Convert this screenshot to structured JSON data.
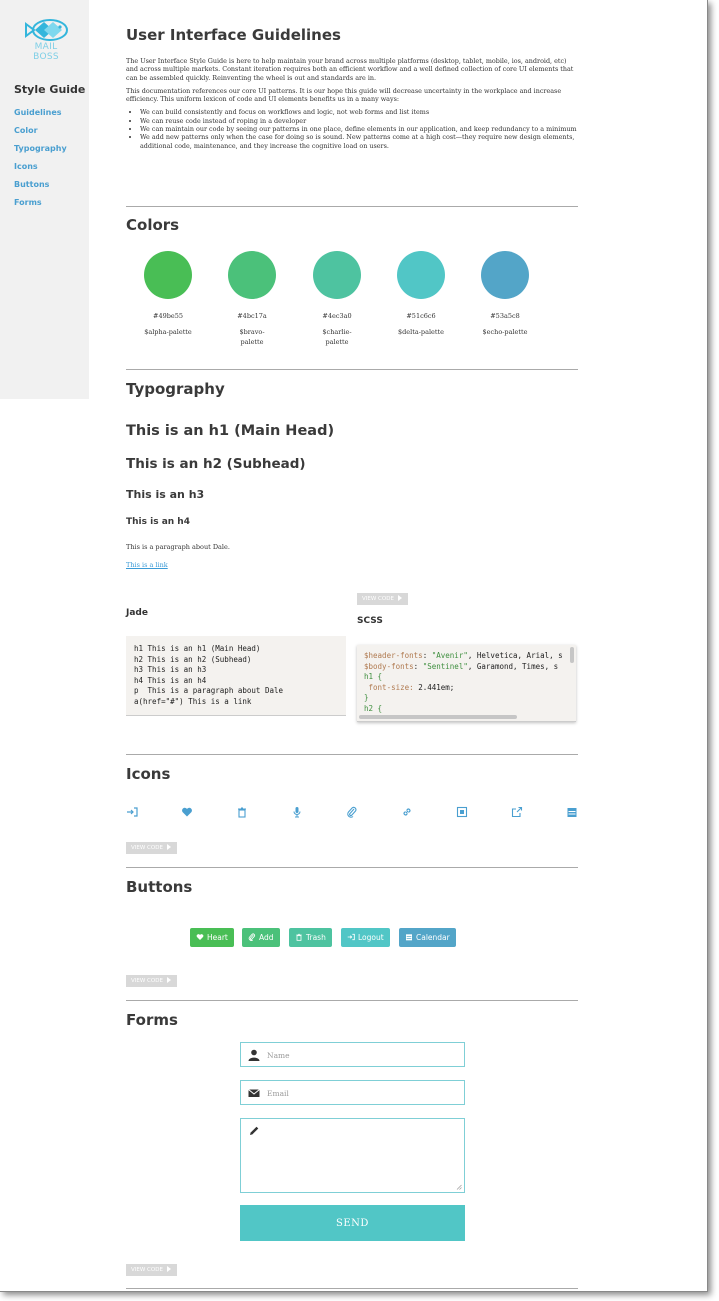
{
  "brand": {
    "logo_line1": "MAIL",
    "logo_line2": "BOSS",
    "accent": "#4a9fd0"
  },
  "sidebar": {
    "title": "Style Guide",
    "items": [
      {
        "label": "Guidelines"
      },
      {
        "label": "Color"
      },
      {
        "label": "Typography"
      },
      {
        "label": "Icons"
      },
      {
        "label": "Buttons"
      },
      {
        "label": "Forms"
      }
    ]
  },
  "intro": {
    "title": "User Interface Guidelines",
    "para1": "The User Interface Style Guide is here to help maintain your brand across multiple platforms (desktop, tablet, mobile, ios, android, etc) and across multiple markets. Constant iteration requires both an efficient workflow and a well defined collection of core UI elements that can be assembled quickly. Reinventing the wheel is out and standards are in.",
    "para2": "This documentation references our core UI patterns. It is our hope this guide will decrease uncertainty in the workplace and increase efficiency. This uniform lexicon of code and UI elements benefits us in a many ways:",
    "bullets": [
      "We can build consistently and focus on workflows and logic, not web forms and list items",
      "We can reuse code instead of roping in a developer",
      "We can maintain our code by seeing our patterns in one place, define elements in our application, and keep redundancy to a minimum",
      "We add new patterns only when the case for doing so is sound. New patterns come at a high cost—they require new design elements, additional code, maintenance, and they increase the cognitive load on users."
    ]
  },
  "colors": {
    "title": "Colors",
    "swatches": [
      {
        "hex": "#49be55",
        "var": "$alpha-palette"
      },
      {
        "hex": "#4bc17a",
        "var": "$bravo-palette"
      },
      {
        "hex": "#4ec3a0",
        "var": "$charlie-palette"
      },
      {
        "hex": "#51c6c6",
        "var": "$delta-palette"
      },
      {
        "hex": "#53a5c8",
        "var": "$echo-palette"
      }
    ]
  },
  "typography": {
    "title": "Typography",
    "h1": "This is an h1 (Main Head)",
    "h2": "This is an h2 (Subhead)",
    "h3": "This is an h3",
    "h4": "This is an h4",
    "p": "This is a paragraph about Dale.",
    "link": "This is a link",
    "view_code": "VIEW CODE",
    "jade_label": "Jade",
    "scss_label": "SCSS",
    "jade_code": "h1 This is an h1 (Main Head)\nh2 This is an h2 (Subhead)\nh3 This is an h3\nh4 This is an h4\np  This is a paragraph about Dale\na(href=\"#\") This is a link",
    "scss": {
      "header_var": "$header-fonts",
      "header_str": "\"Avenir\"",
      "header_rest": ", Helvetica, Arial, s",
      "body_var": "$body-fonts",
      "body_str": "\"Sentinel\"",
      "body_rest": ", Garamond, Times, s",
      "h1_sel": "h1 {",
      "prop": " font-size: ",
      "val": "2.441em",
      "close": "}",
      "h2_sel": "h2 {"
    }
  },
  "icons": {
    "title": "Icons",
    "view_code": "VIEW CODE",
    "items": [
      "logout-icon",
      "heart-icon",
      "trash-icon",
      "microphone-icon",
      "paperclip-icon",
      "link-icon",
      "image-icon",
      "external-link-icon",
      "calendar-icon"
    ]
  },
  "buttons": {
    "title": "Buttons",
    "view_code": "VIEW CODE",
    "items": [
      {
        "label": "Heart",
        "color": "#49be55"
      },
      {
        "label": "Add",
        "color": "#4bc17a"
      },
      {
        "label": "Trash",
        "color": "#4ec3a0"
      },
      {
        "label": "Logout",
        "color": "#51c6c6"
      },
      {
        "label": "Calendar",
        "color": "#53a5c8"
      }
    ]
  },
  "forms": {
    "title": "Forms",
    "name_placeholder": "Name",
    "email_placeholder": "Email",
    "send_label": "SEND",
    "view_code": "VIEW CODE"
  }
}
